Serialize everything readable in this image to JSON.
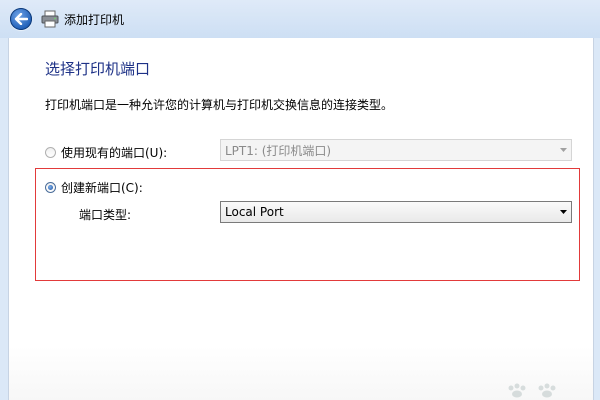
{
  "window": {
    "title": "添加打印机"
  },
  "page": {
    "heading": "选择打印机端口",
    "description": "打印机端口是一种允许您的计算机与打印机交换信息的连接类型。"
  },
  "existing_port": {
    "label": "使用现有的端口(U):",
    "selected": false,
    "value": "LPT1: (打印机端口)",
    "enabled": false
  },
  "new_port": {
    "label": "创建新端口(C):",
    "selected": true,
    "type_label": "端口类型:",
    "type_value": "Local Port"
  },
  "icons": {
    "back": "back-arrow-icon",
    "printer": "printer-icon",
    "dropdown": "chevron-down-icon"
  },
  "colors": {
    "heading": "#1e3287",
    "highlight_border": "#e23a3a",
    "header_bg": "#dfeaf8"
  }
}
